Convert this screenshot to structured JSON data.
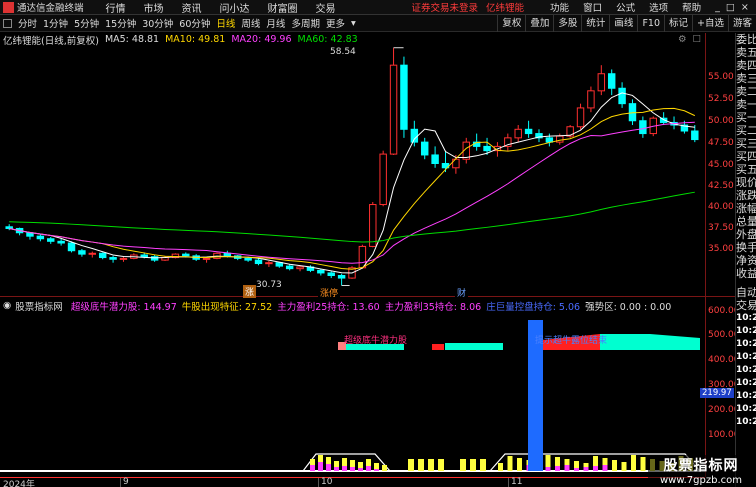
{
  "menubar": {
    "app_title": "通达信金融终端",
    "items": [
      "行情",
      "市场",
      "资讯",
      "问小达",
      "财富圈",
      "交易"
    ],
    "warning": "证券交易未登录",
    "brand": "亿纬锂能",
    "right_items": [
      "功能",
      "窗口",
      "公式",
      "选项",
      "帮助"
    ],
    "win_controls": [
      "_",
      "□",
      "×"
    ]
  },
  "toolbar": {
    "periods": [
      "分时",
      "1分钟",
      "5分钟",
      "15分钟",
      "30分钟",
      "60分钟",
      "日线",
      "周线",
      "月线",
      "多周期",
      "更多"
    ],
    "active_period": "日线",
    "right_buttons": [
      "复权",
      "叠加",
      "多股",
      "统计",
      "画线",
      "F10",
      "标记",
      "+自选",
      "游客"
    ]
  },
  "title": {
    "stock": "亿纬锂能(日线,前复权)",
    "ma5": "MA5: 48.81",
    "ma10": "MA10: 49.81",
    "ma20": "MA20: 49.96",
    "ma60": "MA60: 42.83"
  },
  "colors": {
    "ma5": "#ffffff",
    "ma10": "#ffd700",
    "ma20": "#ff40ff",
    "ma60": "#00dd00",
    "up": "#ff3030",
    "down": "#00ffff"
  },
  "price_axis": [
    "55.00",
    "52.50",
    "50.00",
    "47.50",
    "45.00",
    "42.50",
    "40.00",
    "37.50",
    "35.00"
  ],
  "sub_axis": [
    "600.00",
    "500.00",
    "400.00",
    "300.00",
    "200.00",
    "100.00"
  ],
  "sub_current": "219.97",
  "annotations": {
    "high": "58.54",
    "low": "30.73",
    "tag_zhang": "涨",
    "tag_zhangting": "涨停",
    "tag_cai": "财",
    "sub_text1": "超级底牛潜力股",
    "sub_text2": "提示超牛露位结束"
  },
  "sub_title": {
    "name": "股票指标网",
    "f1": "超级底牛潜力股: 144.97",
    "f2": "牛股出现特征: 27.52",
    "f3": "主力盈利25持仓: 13.60",
    "f4": "主力盈利35持仓: 8.06",
    "f5": "庄巨量控盘持仓: 5.06",
    "f6": "强势区: 0.00 : 0.00"
  },
  "x_axis": {
    "labels": [
      "2024年",
      "9",
      "10",
      "11"
    ]
  },
  "side_panel": {
    "labels": [
      "委比",
      "卖五",
      "卖四",
      "卖三",
      "卖二",
      "卖一",
      "买一",
      "买二",
      "买三",
      "买四",
      "买五",
      "现价",
      "涨跌",
      "涨幅",
      "总量",
      "外盘",
      "换手",
      "净资",
      "收益",
      "自动",
      "交易"
    ],
    "times": [
      "10:24",
      "10:24",
      "10:24",
      "10:24",
      "10:24",
      "10:24",
      "10:24",
      "10:24",
      "10:24"
    ]
  },
  "watermark": {
    "line1": "股票指标网",
    "line2": "www.7gpzb.com"
  },
  "chart_data": {
    "type": "candlestick",
    "candles": [
      [
        37.6,
        37.9,
        37.2,
        37.4
      ],
      [
        37.4,
        37.5,
        36.6,
        36.9
      ],
      [
        36.9,
        37.0,
        36.1,
        36.5
      ],
      [
        36.5,
        36.7,
        35.9,
        36.2
      ],
      [
        36.2,
        36.4,
        35.6,
        35.9
      ],
      [
        35.9,
        36.2,
        35.4,
        35.7
      ],
      [
        35.7,
        35.9,
        34.6,
        34.8
      ],
      [
        34.8,
        35.0,
        34.1,
        34.4
      ],
      [
        34.4,
        34.7,
        34.0,
        34.5
      ],
      [
        34.5,
        34.6,
        33.8,
        34.0
      ],
      [
        34.0,
        34.2,
        33.4,
        33.8
      ],
      [
        33.8,
        34.1,
        33.5,
        33.9
      ],
      [
        33.9,
        34.5,
        33.8,
        34.3
      ],
      [
        34.3,
        34.6,
        33.9,
        34.1
      ],
      [
        34.1,
        34.3,
        33.5,
        33.7
      ],
      [
        33.7,
        34.2,
        33.6,
        34.0
      ],
      [
        34.0,
        34.5,
        33.9,
        34.4
      ],
      [
        34.4,
        34.6,
        34.0,
        34.2
      ],
      [
        34.2,
        34.4,
        33.6,
        33.8
      ],
      [
        33.8,
        34.0,
        33.4,
        33.9
      ],
      [
        33.9,
        34.6,
        33.8,
        34.5
      ],
      [
        34.5,
        34.8,
        34.0,
        34.2
      ],
      [
        34.2,
        34.3,
        33.7,
        33.9
      ],
      [
        33.9,
        34.1,
        33.5,
        33.7
      ],
      [
        33.7,
        33.9,
        33.1,
        33.3
      ],
      [
        33.3,
        33.6,
        32.9,
        33.4
      ],
      [
        33.4,
        33.5,
        32.8,
        33.0
      ],
      [
        33.0,
        33.2,
        32.5,
        32.7
      ],
      [
        32.7,
        33.0,
        32.4,
        32.9
      ],
      [
        32.9,
        33.1,
        32.3,
        32.5
      ],
      [
        32.5,
        32.7,
        31.9,
        32.2
      ],
      [
        32.2,
        32.4,
        31.6,
        31.9
      ],
      [
        31.9,
        32.1,
        30.73,
        31.6
      ],
      [
        31.6,
        33.0,
        31.5,
        32.8
      ],
      [
        32.8,
        35.5,
        32.7,
        35.3
      ],
      [
        35.3,
        40.5,
        35.2,
        40.2
      ],
      [
        40.2,
        46.5,
        40.0,
        46.1
      ],
      [
        46.1,
        58.54,
        46.0,
        56.5
      ],
      [
        56.5,
        57.5,
        48.0,
        49.0
      ],
      [
        49.0,
        50.0,
        47.0,
        47.5
      ],
      [
        47.5,
        48.0,
        45.5,
        46.0
      ],
      [
        46.0,
        47.0,
        44.5,
        45.0
      ],
      [
        45.0,
        46.5,
        44.0,
        44.5
      ],
      [
        44.5,
        46.0,
        43.8,
        45.5
      ],
      [
        45.5,
        48.0,
        45.0,
        47.5
      ],
      [
        47.5,
        48.5,
        46.5,
        47.0
      ],
      [
        47.0,
        48.0,
        46.0,
        46.5
      ],
      [
        46.5,
        47.5,
        45.8,
        47.0
      ],
      [
        47.0,
        48.5,
        46.5,
        48.0
      ],
      [
        48.0,
        49.5,
        47.5,
        49.0
      ],
      [
        49.0,
        50.0,
        48.0,
        48.5
      ],
      [
        48.5,
        49.0,
        47.5,
        48.0
      ],
      [
        48.0,
        48.5,
        47.0,
        47.5
      ],
      [
        47.5,
        48.5,
        47.2,
        48.2
      ],
      [
        48.2,
        49.5,
        48.0,
        49.3
      ],
      [
        49.3,
        52.0,
        49.0,
        51.5
      ],
      [
        51.5,
        54.0,
        51.0,
        53.5
      ],
      [
        53.5,
        56.5,
        53.0,
        55.5
      ],
      [
        55.5,
        56.0,
        53.0,
        53.8
      ],
      [
        53.8,
        54.5,
        51.5,
        52.0
      ],
      [
        52.0,
        52.5,
        49.5,
        50.0
      ],
      [
        50.0,
        50.5,
        48.0,
        48.5
      ],
      [
        48.5,
        50.5,
        48.2,
        50.3
      ],
      [
        50.3,
        51.0,
        49.5,
        49.8
      ],
      [
        49.8,
        50.5,
        49.0,
        49.5
      ],
      [
        49.5,
        50.0,
        48.5,
        48.8
      ],
      [
        48.8,
        49.5,
        47.5,
        47.8
      ]
    ],
    "ylim": [
      30,
      60
    ]
  }
}
